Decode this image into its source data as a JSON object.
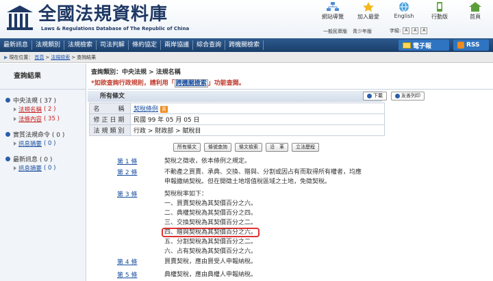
{
  "header": {
    "site_title": "全國法規資料庫",
    "site_subtitle": "Laws & Regulations Database of The Republic of China",
    "top_links": [
      "網站導覽",
      "加入最愛",
      "English",
      "行動版",
      "首頁"
    ],
    "sub_links": [
      "一般民眾版",
      "青少年版"
    ],
    "font_size_label": "字級:"
  },
  "nav": {
    "items": [
      "最新訊息",
      "法規類別",
      "法規檢索",
      "司法判解",
      "條約協定",
      "兩岸協議",
      "綜合查詢",
      "跨機關檢索"
    ],
    "epaper": "電子報",
    "rss": "RSS"
  },
  "breadcrumb": {
    "label": "現在位置：",
    "items": [
      "首頁",
      "法規檢索",
      "查詢結果"
    ]
  },
  "sidebar": {
    "title": "查詢結果",
    "groups": [
      {
        "title": "中央法規 ( 37 )",
        "items": [
          {
            "label": "法規名稱",
            "count": "( 2 )"
          },
          {
            "label": "法條內容",
            "count": "( 35 )"
          }
        ]
      },
      {
        "title": "實質法規命令 ( 0 )",
        "items": [
          {
            "label": "訊息摘要",
            "count": "( 0 )"
          }
        ]
      },
      {
        "title": "最新訊息 ( 0 )",
        "items": [
          {
            "label": "訊息摘要",
            "count": "( 0 )"
          }
        ]
      }
    ]
  },
  "main": {
    "query_line": "查詢類別：中央法規 > 法規名稱",
    "note_prefix": "*如欲查詢行政規則，請利用「",
    "note_link": "跨機關檢索",
    "note_suffix": "」功能查閱。",
    "section_title": "所有條文",
    "download_label": "下載",
    "print_label": "友善列印",
    "info": {
      "name_label": "名　　稱",
      "name_value": "契稅條例",
      "name_tag": "英",
      "date_label": "修正日期",
      "date_value": "民國 99 年 05 月 05 日",
      "category_label": "法規類別",
      "category_value": "行政 > 財政部 > 賦稅目"
    },
    "tool_buttons": [
      "所有條文",
      "條號查詢",
      "條文檢索",
      "沿　革",
      "立法歷程"
    ],
    "articles": [
      {
        "no": "第 1 條",
        "lines": [
          "契稅之徵收，依本條例之規定。"
        ]
      },
      {
        "no": "第 2 條",
        "lines": [
          "不動產之買賣、承典、交換、贈與、分割或因占有而取得所有權者，均應",
          "申報繳納契稅。但在開徵土地增值稅區域之土地，免徵契稅。"
        ]
      },
      {
        "no": "第 3 條",
        "lines": [
          "契稅稅率如下：",
          "一、買賣契稅為其契價百分之六。",
          "二、典權契稅為其契價百分之四。",
          "三、交換契稅為其契價百分之二。",
          "四、贈與契稅為其契價百分之六。",
          "五、分割契稅為其契價百分之二。",
          "六、占有契稅為其契價百分之六。"
        ]
      },
      {
        "no": "第 4 條",
        "lines": [
          "買賣契稅，應由買受人申報納稅。"
        ]
      },
      {
        "no": "第 5 條",
        "lines": [
          "典權契稅，應由典權人申報納稅。"
        ]
      }
    ]
  }
}
